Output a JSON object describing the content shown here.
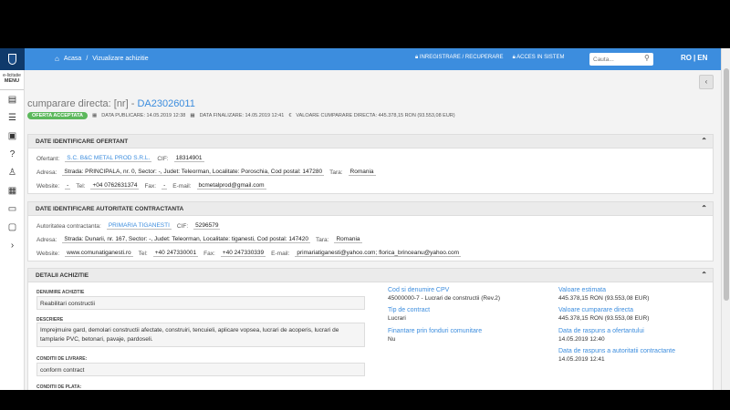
{
  "topbar": {
    "breadcrumb_home": "Acasa",
    "breadcrumb_sep": "/",
    "breadcrumb_current": "Vizualizare achizitie",
    "register_link": "INREGISTRARE / RECUPERARE",
    "access_link": "ACCES IN SISTEM",
    "search_placeholder": "Cauta...",
    "lang_ro": "RO",
    "lang_sep": "|",
    "lang_en": "EN"
  },
  "sidebar": {
    "menu_top": "e-licitatie",
    "menu_label": "MENU",
    "icons": [
      "document-icon",
      "list-icon",
      "book-icon",
      "help-icon",
      "person-icon",
      "id-card-icon",
      "monitor-icon",
      "chat-icon",
      "chevron-right-icon"
    ]
  },
  "header": {
    "title_prefix": "cumparare directa: [nr]",
    "title_sep": " - ",
    "title_code": "DA23026011",
    "badge": "OFERTA ACCEPTATA",
    "publish_label": "DATA PUBLICARE: 14.05.2019 12:38",
    "finalize_label": "DATA FINALIZARE: 14.05.2019 12:41",
    "value_label": "VALOARE CUMPARARE DIRECTA: 445.378,15  RON (93.553,08  EUR)"
  },
  "bidder": {
    "heading": "DATE IDENTIFICARE OFERTANT",
    "ofertant_label": "Ofertant:",
    "ofertant_value": "S.C. B&C METAL PROD S.R.L.",
    "cif_label": "CIF:",
    "cif_value": "18314901",
    "address_label": "Adresa:",
    "address_value": "Strada: PRINCIPALA, nr. 0, Sector: -, Judet: Teleorman, Localitate: Poroschia, Cod postal: 147280",
    "country_label": "Tara:",
    "country_value": "Romania",
    "website_label": "Website:",
    "website_value": "-",
    "tel_label": "Tel:",
    "tel_value": "+04 0762631374",
    "fax_label": "Fax:",
    "fax_value": "-",
    "email_label": "E-mail:",
    "email_value": "bcmetalprod@gmail.com"
  },
  "authority": {
    "heading": "DATE IDENTIFICARE AUTORITATE CONTRACTANTA",
    "authority_label": "Autoritatea contractanta:",
    "authority_value": "PRIMARIA TIGANESTI",
    "cif_label": "CIF:",
    "cif_value": "5296579",
    "address_label": "Adresa:",
    "address_value": "Strada: Dunarii, nr. 167, Sector: -, Judet: Teleorman, Localitate: tiganesti, Cod postal: 147420",
    "country_label": "Tara:",
    "country_value": "Romania",
    "website_label": "Website:",
    "website_value": "www.comunatiganesti.ro",
    "tel_label": "Tel:",
    "tel_value": "+40 247330001",
    "fax_label": "Fax:",
    "fax_value": "+40 247330339",
    "email_label": "E-mail:",
    "email_value": "primariatiganesti@yahoo.com; florica_brinceanu@yahoo.com"
  },
  "details": {
    "heading": "DETALII ACHIZITIE",
    "name_label": "DENUMIRE ACHIZITIE",
    "name_value": "Reabilitari constructii",
    "desc_label": "DESCRIERE",
    "desc_value": "Imprejmuire gard, demolari constructii afectate, construiri, tencuieli, aplicare vopsea, lucrari de acoperis, lucrari de tamplarie PVC, betonari, pavaje, pardoseli.",
    "delivery_label": "CONDITII DE LIVRARE:",
    "delivery_value": "conform contract",
    "payment_label": "CONDITII DE PLATA:",
    "cpv_label": "Cod si denumire CPV",
    "cpv_value": "45000000-7 - Lucrari de constructii (Rev.2)",
    "contract_type_label": "Tip de contract",
    "contract_type_value": "Lucrari",
    "eu_funds_label": "Finantare prin fonduri comunitare",
    "eu_funds_value": "Nu",
    "estimated_label": "Valoare estimata",
    "estimated_value": "445.378,15  RON (93.553,08  EUR)",
    "purchase_value_label": "Valoare cumparare directa",
    "purchase_value_value": "445.378,15  RON (93.553,08  EUR)",
    "bidder_reply_label": "Data de raspuns a ofertantului",
    "bidder_reply_value": "14.05.2019 12:40",
    "authority_reply_label": "Data de raspuns a autoritatii contractante",
    "authority_reply_value": "14.05.2019 12:41"
  }
}
